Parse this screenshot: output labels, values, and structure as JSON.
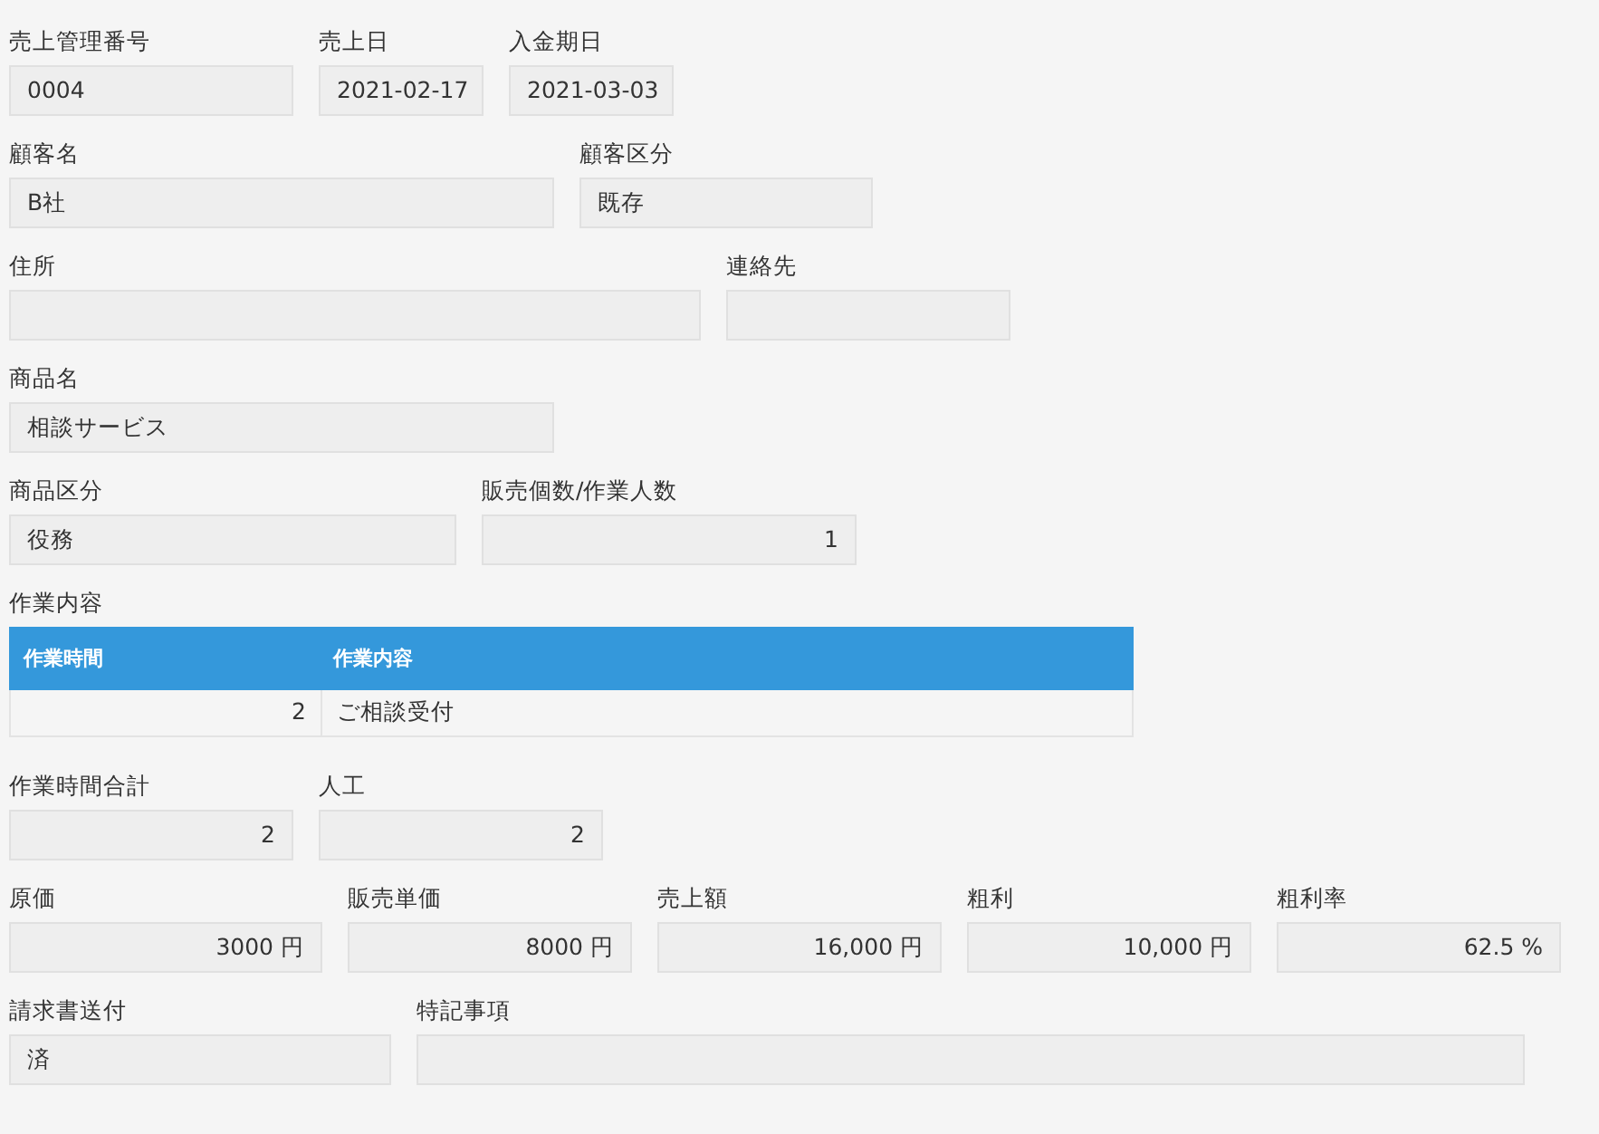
{
  "sections": [
    {
      "kind": "fields",
      "fields": [
        {
          "label": "売上管理番号",
          "value": "0004",
          "kind": "text"
        },
        {
          "label": "売上日",
          "value": "2021-02-17",
          "kind": "text"
        },
        {
          "label": "入金期日",
          "value": "2021-03-03",
          "kind": "text"
        }
      ]
    },
    {
      "kind": "fields",
      "fields": [
        {
          "label": "顧客名",
          "value": "B社",
          "kind": "text"
        },
        {
          "label": "顧客区分",
          "value": "既存",
          "kind": "text"
        }
      ]
    },
    {
      "kind": "fields",
      "fields": [
        {
          "label": "住所",
          "kind": "text"
        },
        {
          "label": "連絡先",
          "kind": "text"
        }
      ]
    },
    {
      "kind": "fields",
      "fields": [
        {
          "label": "商品名",
          "value": "相談サービス",
          "kind": "text"
        }
      ]
    },
    {
      "kind": "fields",
      "fields": [
        {
          "label": "商品区分",
          "value": "役務",
          "kind": "text"
        },
        {
          "label": "販売個数/作業人数",
          "value": "1",
          "kind": "number"
        }
      ]
    },
    {
      "kind": "table",
      "label": "作業内容",
      "columns": [
        "作業時間",
        "作業内容"
      ],
      "rows": [
        [
          {
            "value": "2",
            "kind": "number"
          },
          {
            "value": "ご相談受付",
            "kind": "text"
          }
        ]
      ]
    },
    {
      "kind": "fields",
      "fields": [
        {
          "label": "作業時間合計",
          "value": "2",
          "kind": "number"
        },
        {
          "label": "人工",
          "value": "2",
          "kind": "number"
        }
      ]
    },
    {
      "kind": "fields",
      "fields": [
        {
          "label": "原価",
          "value": "3000 円",
          "kind": "number"
        },
        {
          "label": "販売単価",
          "value": "8000 円",
          "kind": "number"
        },
        {
          "label": "売上額",
          "value": "16,000 円",
          "kind": "number"
        },
        {
          "label": "粗利",
          "value": "10,000 円",
          "kind": "number"
        },
        {
          "label": "粗利率",
          "value": "62.5 %",
          "kind": "number"
        }
      ]
    },
    {
      "kind": "fields",
      "fields": [
        {
          "label": "請求書送付",
          "value": "済",
          "kind": "text"
        },
        {
          "label": "特記事項",
          "kind": "text"
        }
      ]
    }
  ]
}
